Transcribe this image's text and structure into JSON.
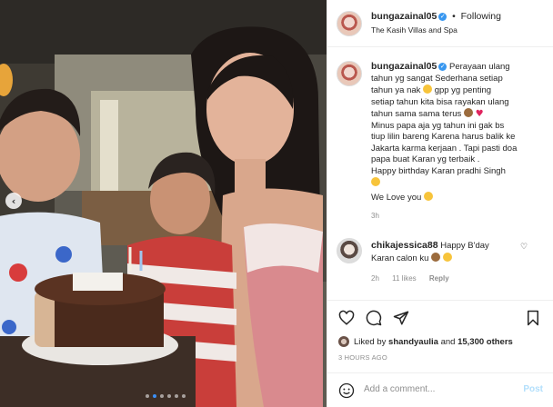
{
  "post": {
    "image_description_alt": "",
    "carousel": {
      "current_index": 1,
      "count": 6
    }
  },
  "header": {
    "username": "bungazainal05",
    "follow_separator": "•",
    "follow_label": "Following",
    "location": "The Kasih Villas and Spa"
  },
  "caption": {
    "username": "bungazainal05",
    "lines": [
      "Perayaan ulang",
      "tahun yg sangat Sederhana setiap",
      "tahun ya nak",
      "gpp yg penting",
      "setiap tahun kita bisa rayakan ulang",
      "tahun sama sama terus",
      "Minus papa aja yg tahun ini gak bs",
      "tiup lilin bareng Karena harus balik ke",
      "Jakarta karma kerjaan . Tapi pasti doa",
      "papa buat Karan yg terbaik .",
      "Happy birthday Karan pradhi Singh",
      "We Love you"
    ],
    "age": "3h"
  },
  "comment": {
    "username": "chikajessica88",
    "text_1": "Happy B'day",
    "text_2": "Karan calon ku",
    "age": "2h",
    "likes": "11 likes",
    "reply": "Reply"
  },
  "likes": {
    "prefix": "Liked by",
    "user": "shandyaulia",
    "middle": "and",
    "others": "15,300 others"
  },
  "timestamp": "3 HOURS AGO",
  "comment_input": {
    "placeholder": "Add a comment...",
    "post_label": "Post"
  },
  "colors": {
    "link_blue": "#3897f0",
    "post_disabled": "#b2dffc",
    "meta_gray": "#8e8e8e"
  }
}
